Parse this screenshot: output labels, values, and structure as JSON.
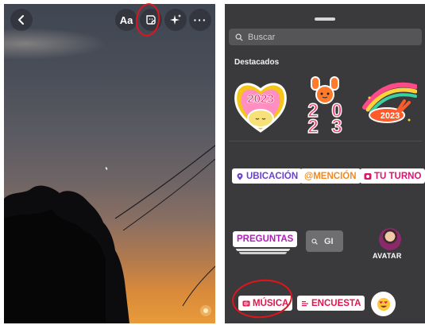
{
  "story_camera": {
    "text_tool_label": "Aa",
    "more_label": "···",
    "icons": {
      "back": "chevron-left-icon",
      "sticker": "sticker-icon",
      "effects": "sparkles-icon",
      "more": "more-horizontal-icon"
    }
  },
  "sticker_tray": {
    "search": {
      "placeholder": "Buscar",
      "value": ""
    },
    "featured_title": "Destacados",
    "featured_stickers": [
      {
        "label": "2023"
      },
      {
        "label": "2023"
      },
      {
        "label": "2023"
      }
    ],
    "stickers": {
      "location": "UBICACIÓN",
      "mention": "@MENCIÓN",
      "your_turn": "TU TURNO",
      "questions": "PREGUNTAS",
      "gif": "GI",
      "avatar": "AVATAR",
      "music": "MÚSICA",
      "poll": "ENCUESTA",
      "emoji_slider": "😍"
    }
  },
  "colors": {
    "tray_background": "#3a3a3c",
    "annotation_red": "#e0151b",
    "location_purple": "#6b3fd3",
    "mention_orange": "#f08a24",
    "yourturn_pink": "#d8166f",
    "questions_purple": "#b020b8",
    "music_red": "#e0154b"
  }
}
